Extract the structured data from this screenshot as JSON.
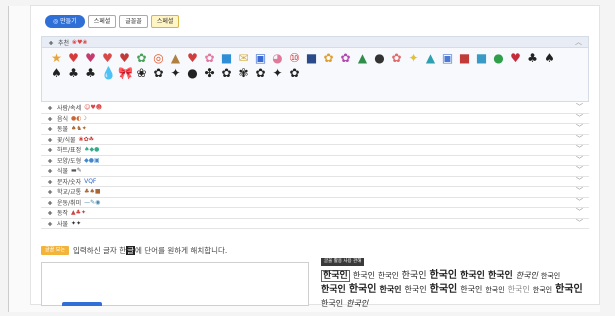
{
  "toolbar": {
    "buttons": [
      {
        "label": "◎ 만들기",
        "style": "primary"
      },
      {
        "label": "스페셜",
        "style": "normal"
      },
      {
        "label": "글꼴꼴",
        "style": "normal"
      },
      {
        "label": "스페셜",
        "style": "active"
      }
    ]
  },
  "favorites": {
    "title": "추천",
    "title_icons": "❀♥❀",
    "emojis": [
      "★",
      "♥",
      "♥",
      "♥",
      "♥",
      "✿",
      "◎",
      "▲",
      "♥",
      "✿",
      "■",
      "✉",
      "▣",
      "◕",
      "⑩",
      "■",
      "✿",
      "✿",
      "▲",
      "●",
      "✿",
      "✦",
      "▲",
      "▣",
      "■",
      "■",
      "●",
      "♥",
      "♣",
      "♠",
      "♠",
      "♣",
      "♣",
      "💧",
      "🎀",
      "❀",
      "✿",
      "✦",
      "●",
      "✤",
      "✿",
      "✾",
      "✿",
      "✦",
      "✿"
    ]
  },
  "categories": [
    {
      "label": "사람/속세",
      "icons": "☺♥☻"
    },
    {
      "label": "음식",
      "icons": "●◐☽"
    },
    {
      "label": "동물",
      "icons": "♠♞✦"
    },
    {
      "label": "꽃/식물",
      "icons": "❀✿☘"
    },
    {
      "label": "하트/표정",
      "icons": "♠◆●"
    },
    {
      "label": "모양/도형",
      "icons": "◆●▣"
    },
    {
      "label": "식물",
      "icons": "▬✎"
    },
    {
      "label": "문자/숫자",
      "icons": "VQF"
    },
    {
      "label": "학교/교통",
      "icons": "♣♠■"
    },
    {
      "label": "운동/취미",
      "icons": "—✎◉"
    },
    {
      "label": "동작",
      "icons": "▲♣✦"
    },
    {
      "label": "사물",
      "icons": "✦✦"
    }
  ],
  "instruction": {
    "tag": "글꼴 보는",
    "before": "입력하신 글자 ",
    "char1": "한",
    "highlight": "글",
    "after": "에 단어를 원하게 해치합니다."
  },
  "preview": {
    "tag": "글꼴 활용 사용 관해",
    "words": [
      "한국인",
      "한국인",
      "한국인",
      "한국인",
      "한국인",
      "한국인",
      "한국인",
      "한국인",
      "한국인",
      "한국인",
      "한국인",
      "한국인",
      "한국인",
      "한국인",
      "한국인",
      "한국인",
      "한국인",
      "한국인",
      "한국인",
      "한국인",
      "한국인"
    ]
  }
}
